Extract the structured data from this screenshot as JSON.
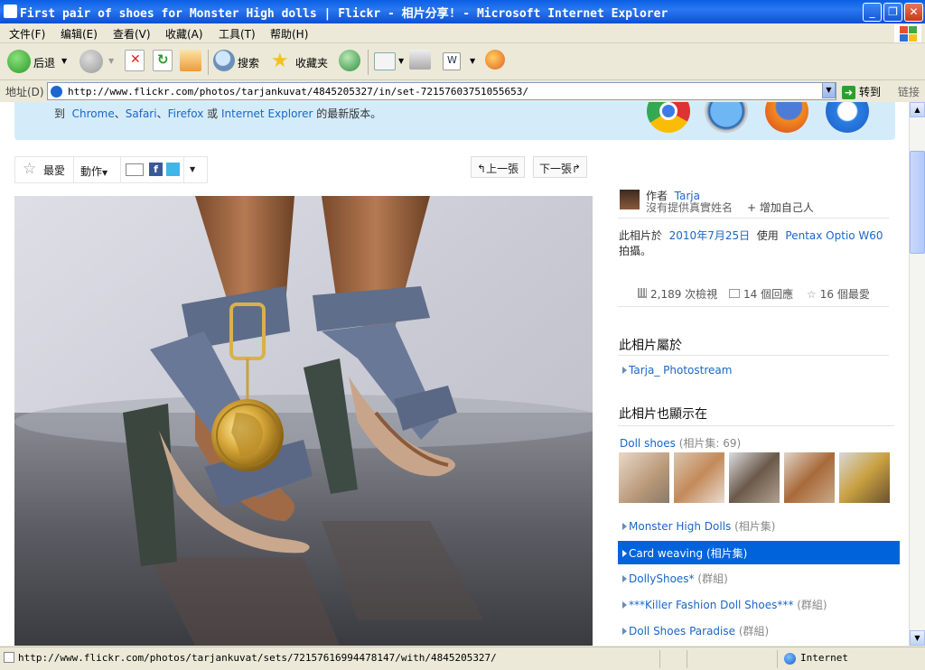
{
  "window": {
    "title": "First pair of shoes for Monster High dolls | Flickr - 相片分享! - Microsoft Internet Explorer"
  },
  "menu": [
    "文件(F)",
    "编辑(E)",
    "查看(V)",
    "收藏(A)",
    "工具(T)",
    "帮助(H)"
  ],
  "toolbar": {
    "back_label": "后退",
    "search_label": "搜索",
    "favorites_label": "收藏夹"
  },
  "address": {
    "label": "地址(D)",
    "url": "http://www.flickr.com/photos/tarjankuvat/4845205327/in/set-72157603751055653/",
    "go_label": "转到",
    "links_label": "链接"
  },
  "banner": {
    "prefix": "到",
    "link_chrome": "Chrome",
    "sep1": "、",
    "link_safari": "Safari",
    "sep2": "、",
    "link_firefox": "Firefox",
    "or": "或",
    "link_ie": "Internet Explorer",
    "suffix": "的最新版本。"
  },
  "actions": {
    "fave_label": "最愛",
    "actions_label": "動作",
    "prev_label": "上一張",
    "next_label": "下一張"
  },
  "sidebar": {
    "by_label": "作者",
    "author": "Tarja",
    "no_name": "沒有提供真實姓名",
    "add_contact": "+ 增加自己人",
    "taken_prefix": "此相片於",
    "taken_date": "2010年7月25日",
    "taken_using": "使用",
    "camera": "Pentax Optio W60",
    "taken_suffix": "拍攝。",
    "views": "2,189 次檢視",
    "comments": "14 個回應",
    "faves": "16 個最愛",
    "belongs_heading": "此相片屬於",
    "photostream": "Tarja_ Photostream",
    "appears_heading": "此相片也顯示在",
    "set1_name": "Doll shoes",
    "set1_meta": "(相片集: 69)",
    "sets": [
      {
        "name": "Monster High Dolls",
        "kind": "(相片集)"
      },
      {
        "name": "Card weaving",
        "kind": "(相片集)"
      },
      {
        "name": "DollyShoes*",
        "kind": "(群組)"
      },
      {
        "name": "***Killer Fashion Doll Shoes***",
        "kind": "(群組)"
      },
      {
        "name": "Doll Shoes Paradise",
        "kind": "(群組)"
      }
    ]
  },
  "status": {
    "url": "http://www.flickr.com/photos/tarjankuvat/sets/72157616994478147/with/4845205327/",
    "zone": "Internet"
  }
}
